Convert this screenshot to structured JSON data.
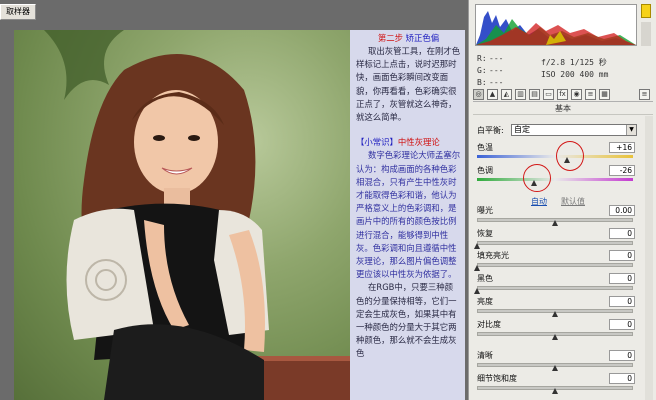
{
  "toolbar": {
    "sampler_button": "取样器"
  },
  "article": {
    "step_label": "第二步",
    "step_title": "矫正色偏",
    "para1": "取出灰管工具，在刚才色样标记上点击，说时迟那时快，画面色彩瞬间改变面貌，你再看看，色彩确实很正点了，灰管就这么神奇，就这么简单。",
    "tip_open": "【小常识】",
    "tip_title": "中性灰理论",
    "para2": "数字色彩理论大师孟塞尔认为：构成画面的各种色彩相混合，只有产生中性灰时才能取得色彩和谐，他认为严格意义上的色彩调和，是画片中的所有的颜色按比例进行混合，能够得到中性灰。色彩调和向且遵循中性灰理论，那么图片偏色调整更应该以中性灰为依据了。",
    "para3": "在RGB中，只要三种颜色的分量保持相等，它们一定会生成灰色，如果其中有一种颜色的分量大于其它两种颜色，那么就不会生成灰色"
  },
  "readout": {
    "r_label": "R:",
    "g_label": "G:",
    "b_label": "B:",
    "r_value": "---",
    "g_value": "---",
    "b_value": "---",
    "aperture_shutter": "f/2.8  1/125 秒",
    "iso_focal": "ISO 200  400 mm"
  },
  "panel": {
    "section_title": "基本",
    "white_balance_label": "白平衡:",
    "white_balance_value": "自定",
    "sliders": [
      {
        "label": "色温",
        "value": "+16",
        "fraction": 0.58
      },
      {
        "label": "色调",
        "value": "-26",
        "fraction": 0.37
      },
      {
        "label": "曝光",
        "value": "0.00",
        "fraction": 0.5
      },
      {
        "label": "恢复",
        "value": "0",
        "fraction": 0.0
      },
      {
        "label": "填充亮光",
        "value": "0",
        "fraction": 0.0
      },
      {
        "label": "黑色",
        "value": "0",
        "fraction": 0.0
      },
      {
        "label": "亮度",
        "value": "0",
        "fraction": 0.5
      },
      {
        "label": "对比度",
        "value": "0",
        "fraction": 0.5
      },
      {
        "label": "清晰",
        "value": "0",
        "fraction": 0.5
      },
      {
        "label": "细节饱和度",
        "value": "0",
        "fraction": 0.5
      }
    ],
    "auto_link": "自动",
    "default_link": "默认值"
  },
  "colors": {
    "annotation_circle": "#d21818",
    "link_blue": "#1a4fb0",
    "article_bg": "#d7d9ec"
  }
}
